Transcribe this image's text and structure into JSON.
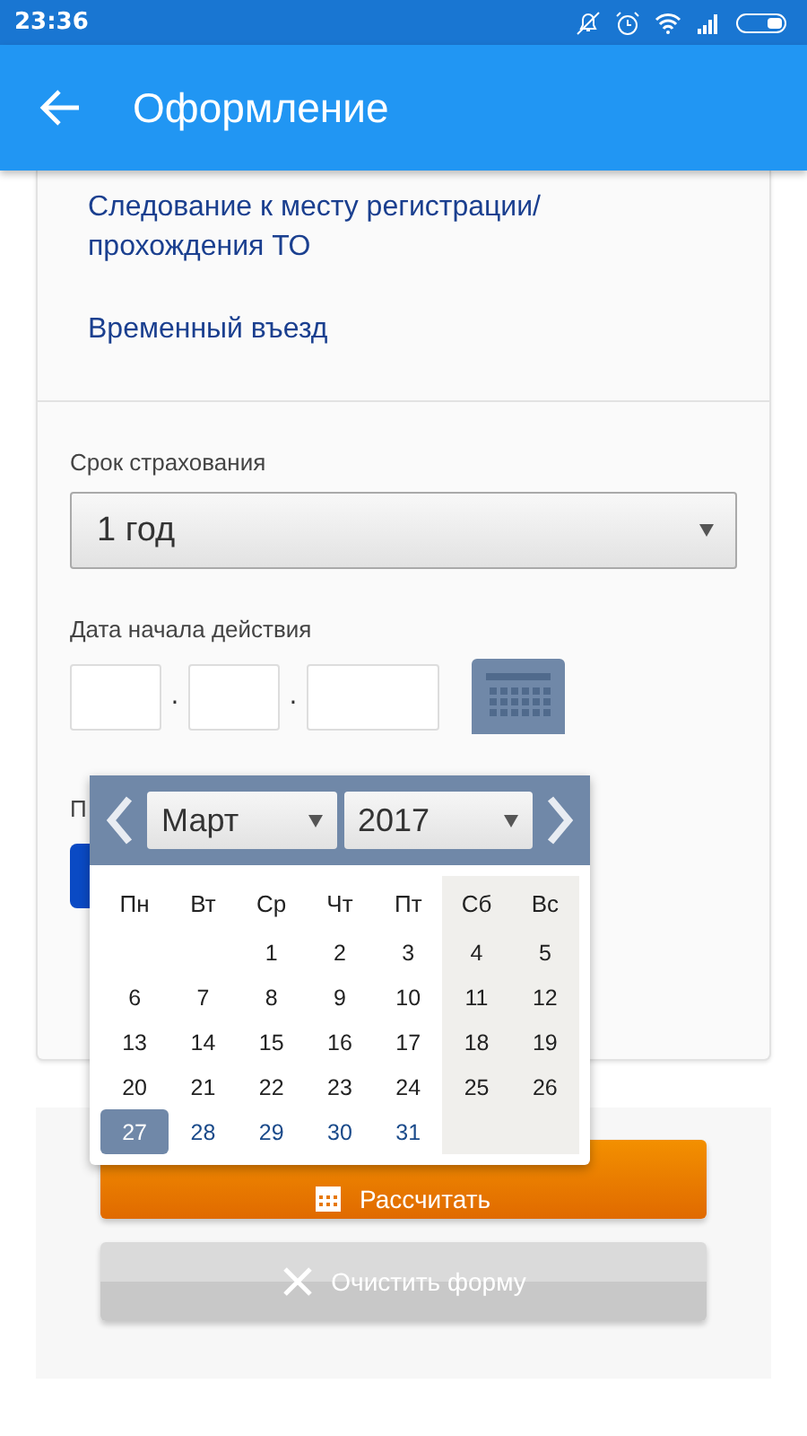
{
  "status_bar": {
    "time": "23:36"
  },
  "app_bar": {
    "title": "Оформление"
  },
  "links": [
    "Следование к месту регистрации/ прохождения ТО",
    "Временный въезд"
  ],
  "term": {
    "label": "Срок страхования",
    "value": "1 год"
  },
  "start_date": {
    "label": "Дата начала действия",
    "separators": [
      ".",
      "."
    ]
  },
  "covered_label": "П",
  "calendar": {
    "month": "Март",
    "year": "2017",
    "weekdays": [
      "Пн",
      "Вт",
      "Ср",
      "Чт",
      "Пт",
      "Сб",
      "Вс"
    ],
    "days": [
      {
        "label": "1",
        "disabled": true,
        "selected": false
      },
      {
        "label": "2",
        "disabled": true,
        "selected": false
      },
      {
        "label": "3",
        "disabled": true,
        "selected": false
      },
      {
        "label": "4",
        "disabled": true,
        "selected": false
      },
      {
        "label": "5",
        "disabled": true,
        "selected": false
      },
      {
        "label": "6",
        "disabled": true,
        "selected": false
      },
      {
        "label": "7",
        "disabled": true,
        "selected": false
      },
      {
        "label": "8",
        "disabled": true,
        "selected": false
      },
      {
        "label": "9",
        "disabled": true,
        "selected": false
      },
      {
        "label": "10",
        "disabled": true,
        "selected": false
      },
      {
        "label": "11",
        "disabled": true,
        "selected": false
      },
      {
        "label": "12",
        "disabled": true,
        "selected": false
      },
      {
        "label": "13",
        "disabled": true,
        "selected": false
      },
      {
        "label": "14",
        "disabled": true,
        "selected": false
      },
      {
        "label": "15",
        "disabled": true,
        "selected": false
      },
      {
        "label": "16",
        "disabled": true,
        "selected": false
      },
      {
        "label": "17",
        "disabled": true,
        "selected": false
      },
      {
        "label": "18",
        "disabled": true,
        "selected": false
      },
      {
        "label": "19",
        "disabled": true,
        "selected": false
      },
      {
        "label": "20",
        "disabled": true,
        "selected": false
      },
      {
        "label": "21",
        "disabled": true,
        "selected": false
      },
      {
        "label": "22",
        "disabled": true,
        "selected": false
      },
      {
        "label": "23",
        "disabled": true,
        "selected": false
      },
      {
        "label": "24",
        "disabled": true,
        "selected": false
      },
      {
        "label": "25",
        "disabled": true,
        "selected": false
      },
      {
        "label": "26",
        "disabled": true,
        "selected": false
      },
      {
        "label": "27",
        "disabled": false,
        "selected": true
      },
      {
        "label": "28",
        "disabled": false,
        "selected": false
      },
      {
        "label": "29",
        "disabled": false,
        "selected": false
      },
      {
        "label": "30",
        "disabled": false,
        "selected": false
      },
      {
        "label": "31",
        "disabled": false,
        "selected": false
      }
    ]
  },
  "buttons": [
    {
      "kind": "primary",
      "label": "Рассчитать"
    },
    {
      "kind": "secondary",
      "label": "Очистить форму"
    }
  ]
}
